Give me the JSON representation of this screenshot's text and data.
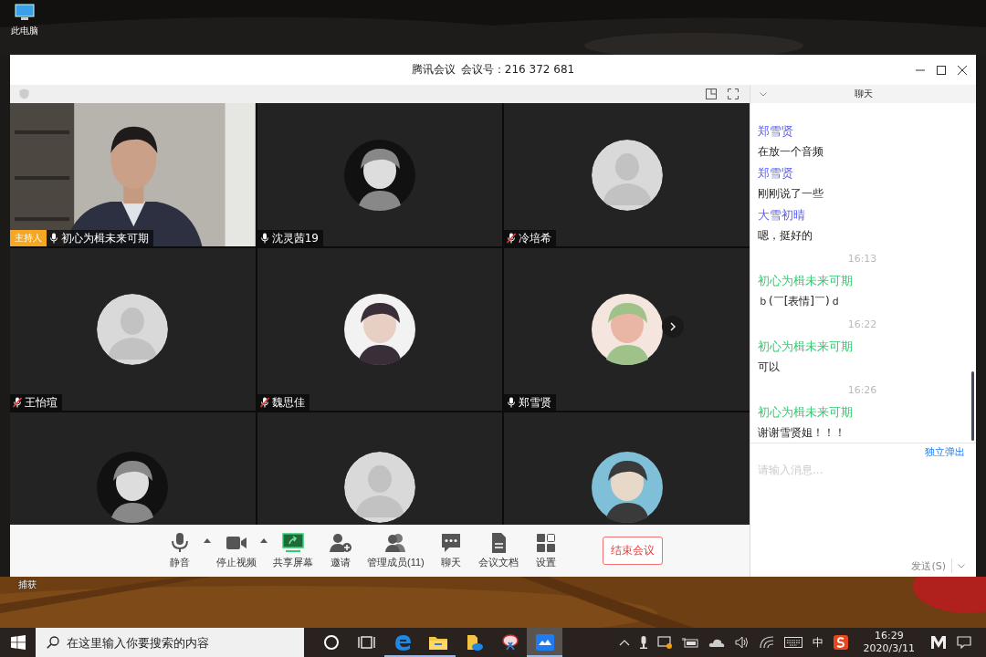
{
  "desktop": {
    "icons": [
      {
        "label": "此电脑",
        "kind": "computer"
      },
      {
        "label": "捕获",
        "kind": "hidden"
      }
    ]
  },
  "window": {
    "app_name": "腾讯会议",
    "meeting_id": "会议号：216 372 681"
  },
  "tiles": [
    {
      "kind": "video",
      "name": "初心为楫未来可期",
      "muted": false,
      "host_badge": "主持人"
    },
    {
      "kind": "avatar",
      "name": "沈灵茜19",
      "muted": false
    },
    {
      "kind": "silhouette",
      "name": "冷培希",
      "muted": true
    },
    {
      "kind": "silhouette",
      "name": "王怡瑄",
      "muted": true
    },
    {
      "kind": "avatar",
      "name": "魏思佳",
      "muted": true
    },
    {
      "kind": "avatar",
      "name": "郑雪贤",
      "muted": false
    },
    {
      "kind": "avatar"
    },
    {
      "kind": "silhouette"
    },
    {
      "kind": "avatar"
    }
  ],
  "toolbar": {
    "buttons": [
      {
        "kind": "mic",
        "label": "静音",
        "menu": true
      },
      {
        "kind": "video",
        "label": "停止视频",
        "menu": true
      },
      {
        "kind": "share",
        "label": "共享屏幕",
        "menu": false
      },
      {
        "kind": "invite",
        "label": "邀请",
        "menu": false
      },
      {
        "kind": "members",
        "label": "管理成员(11)",
        "menu": false
      },
      {
        "kind": "chat",
        "label": "聊天",
        "menu": false
      },
      {
        "kind": "docs",
        "label": "会议文档",
        "menu": false
      },
      {
        "kind": "settings",
        "label": "设置",
        "menu": false
      }
    ],
    "end_button": "结束会议"
  },
  "chat": {
    "title": "聊天",
    "messages": [
      {
        "kind": "message",
        "sender": "郑雪贤",
        "color": "#5b5ef0",
        "text": "在放一个音频"
      },
      {
        "kind": "message",
        "sender": "郑雪贤",
        "color": "#5b5ef0",
        "text": "刚刚说了一些"
      },
      {
        "kind": "message",
        "sender": "大雪初晴",
        "color": "#5b5ef0",
        "text": "嗯，挺好的"
      },
      {
        "kind": "time",
        "text": "16:13"
      },
      {
        "kind": "message",
        "sender": "初心为楫未来可期",
        "color": "#2fcf6f",
        "text": "ｂ(￣[表情]￣)ｄ"
      },
      {
        "kind": "time",
        "text": "16:22"
      },
      {
        "kind": "message",
        "sender": "初心为楫未来可期",
        "color": "#2fcf6f",
        "text": "可以"
      },
      {
        "kind": "time",
        "text": "16:26"
      },
      {
        "kind": "message",
        "sender": "初心为楫未来可期",
        "color": "#2fcf6f",
        "text": "谢谢雪贤姐！！！"
      }
    ],
    "popout_link": "独立弹出",
    "input": {
      "placeholder": "请输入消息..."
    },
    "send_button": "发送(S)"
  },
  "taskbar": {
    "search": {
      "placeholder": "在这里输入你要搜索的内容"
    },
    "apps": [
      {
        "kind": "cortana",
        "running": false,
        "selected": false
      },
      {
        "kind": "taskview",
        "running": false,
        "selected": false
      },
      {
        "kind": "browser",
        "running": true,
        "selected": false
      },
      {
        "kind": "folder",
        "running": true,
        "selected": false
      },
      {
        "kind": "cloudfolder",
        "running": false,
        "selected": false
      },
      {
        "kind": "snip",
        "running": false,
        "selected": false
      },
      {
        "kind": "meeting",
        "running": true,
        "selected": true
      }
    ],
    "tray": {
      "ime": "中",
      "time": "16:29",
      "date": "2020/3/11"
    }
  }
}
